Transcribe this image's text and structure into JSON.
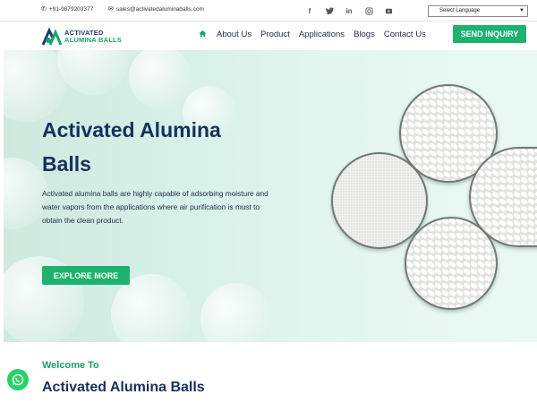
{
  "topbar": {
    "phone": "+91-9879203377",
    "email": "sales@activatedaluminaballs.com",
    "social": [
      "f",
      "t",
      "in",
      "ig",
      "yt"
    ],
    "language": "Select Language"
  },
  "nav": {
    "logo_line1": "ACTIVATED",
    "logo_line2": "ALUMINA BALLS",
    "items": [
      "About Us",
      "Product",
      "Applications",
      "Blogs",
      "Contact Us"
    ],
    "cta": "SEND INQUIRY"
  },
  "hero": {
    "title": "Activated Alumina Balls",
    "description": "Activated alumina balls are highly capable of adsorbing moisture and water vapors from the applications where air purification is must to obtain the clean product.",
    "button": "EXPLORE MORE"
  },
  "welcome": {
    "subtitle": "Welcome To",
    "title": "Activated Alumina Balls"
  },
  "colors": {
    "brand_green": "#1db36e",
    "navy": "#16305e"
  }
}
